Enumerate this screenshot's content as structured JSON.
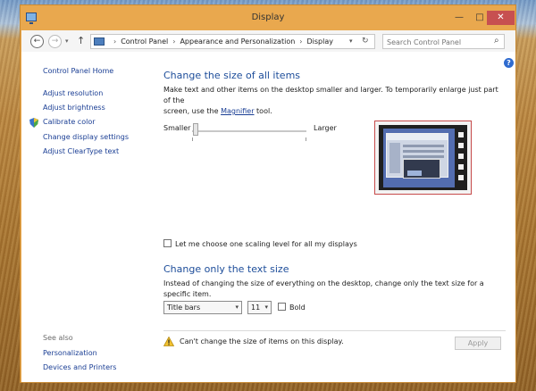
{
  "window": {
    "title": "Display",
    "minimize": "—",
    "maximize": "□",
    "close": "✕"
  },
  "nav": {
    "back": "←",
    "forward": "→",
    "history_dropdown": "▾",
    "up": "↑"
  },
  "breadcrumbs": {
    "sep1": "›",
    "item1": "Control Panel",
    "sep2": "›",
    "item2": "Appearance and Personalization",
    "sep3": "›",
    "item3": "Display",
    "dropdown": "▾",
    "refresh": "↻"
  },
  "search": {
    "placeholder": "Search Control Panel",
    "icon": "⌕"
  },
  "sidebar": {
    "home": "Control Panel Home",
    "links": [
      "Adjust resolution",
      "Adjust brightness",
      "Calibrate color",
      "Change display settings",
      "Adjust ClearType text"
    ],
    "see_also_label": "See also",
    "see_also": [
      "Personalization",
      "Devices and Printers"
    ]
  },
  "help": "?",
  "section1": {
    "heading": "Change the size of all items",
    "desc_part1": "Make text and other items on the desktop smaller and larger. To temporarily enlarge just part of the",
    "desc_part2": "screen, use the ",
    "magnifier_link": "Magnifier",
    "desc_part3": " tool.",
    "smaller": "Smaller",
    "larger": "Larger",
    "slider_level": 0
  },
  "scaling_checkbox": "Let me choose one scaling level for all my displays",
  "section2": {
    "heading": "Change only the text size",
    "desc": "Instead of changing the size of everything on the desktop, change only the text size for a specific item.",
    "item_select": "Title bars",
    "size_select": "11",
    "select_arrow": "▾",
    "bold_label": "Bold"
  },
  "footer": {
    "warning": "Can't change the size of items on this display.",
    "apply": "Apply"
  },
  "colors": {
    "window_frame": "#e9a84e",
    "link": "#1a3e94",
    "heading": "#1d4d9a",
    "close_button": "#c75050"
  }
}
